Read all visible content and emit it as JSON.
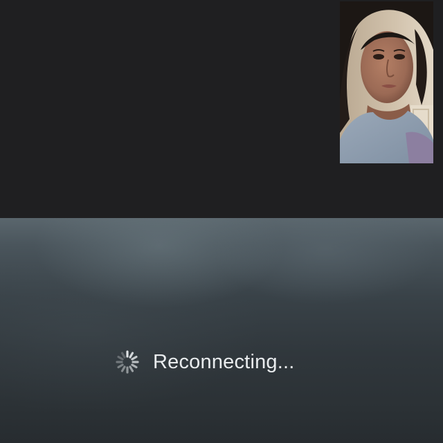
{
  "call": {
    "status_text": "Reconnecting...",
    "status_icon": "spinner-icon",
    "self_view_icon": "self-view-camera-feed"
  },
  "colors": {
    "top_background": "#1f1f21",
    "video_background": "#394248",
    "status_text": "#e9ecee"
  }
}
